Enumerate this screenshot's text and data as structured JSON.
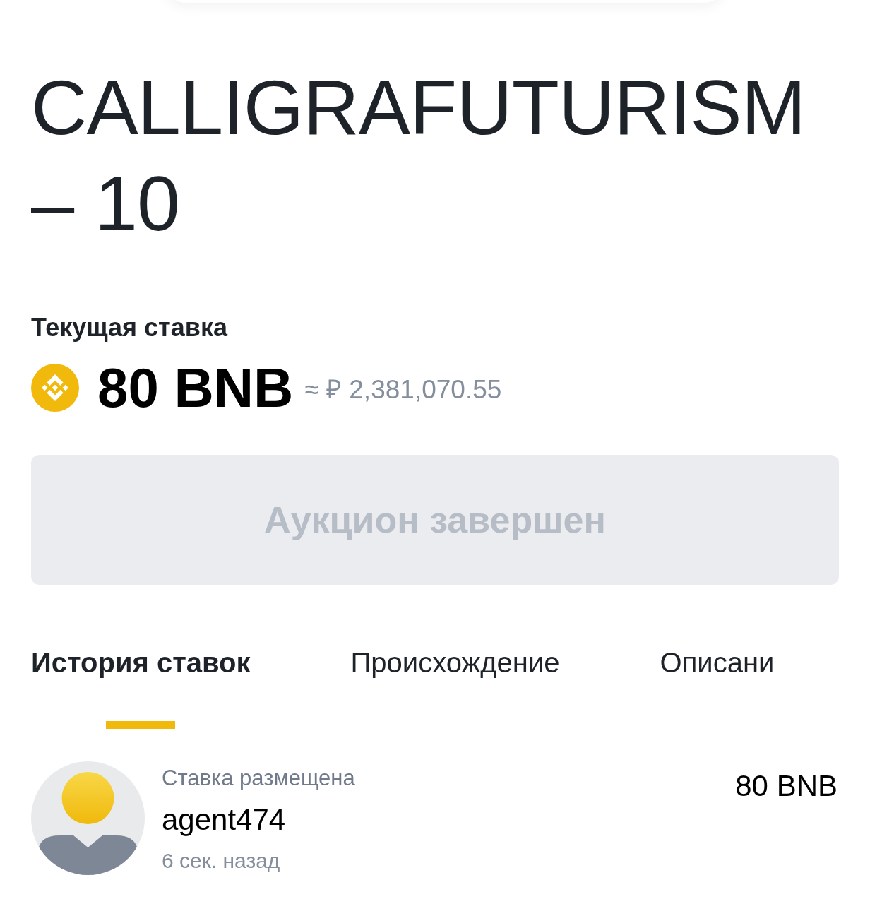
{
  "title": "CALLIGRAFUTURISM – 10",
  "current_bid": {
    "label": "Текущая ставка",
    "amount": "80 BNB",
    "fiat": "≈ ₽ 2,381,070.55"
  },
  "action_button": {
    "label": "Аукцион завершен",
    "disabled": true
  },
  "tabs": [
    {
      "label": "История ставок",
      "selected": true
    },
    {
      "label": "Происхождение",
      "selected": false
    },
    {
      "label": "Описани",
      "selected": false
    }
  ],
  "bids": [
    {
      "caption": "Ставка размещена",
      "user": "agent474",
      "time": "6 сек. назад",
      "amount": "80 BNB"
    }
  ]
}
